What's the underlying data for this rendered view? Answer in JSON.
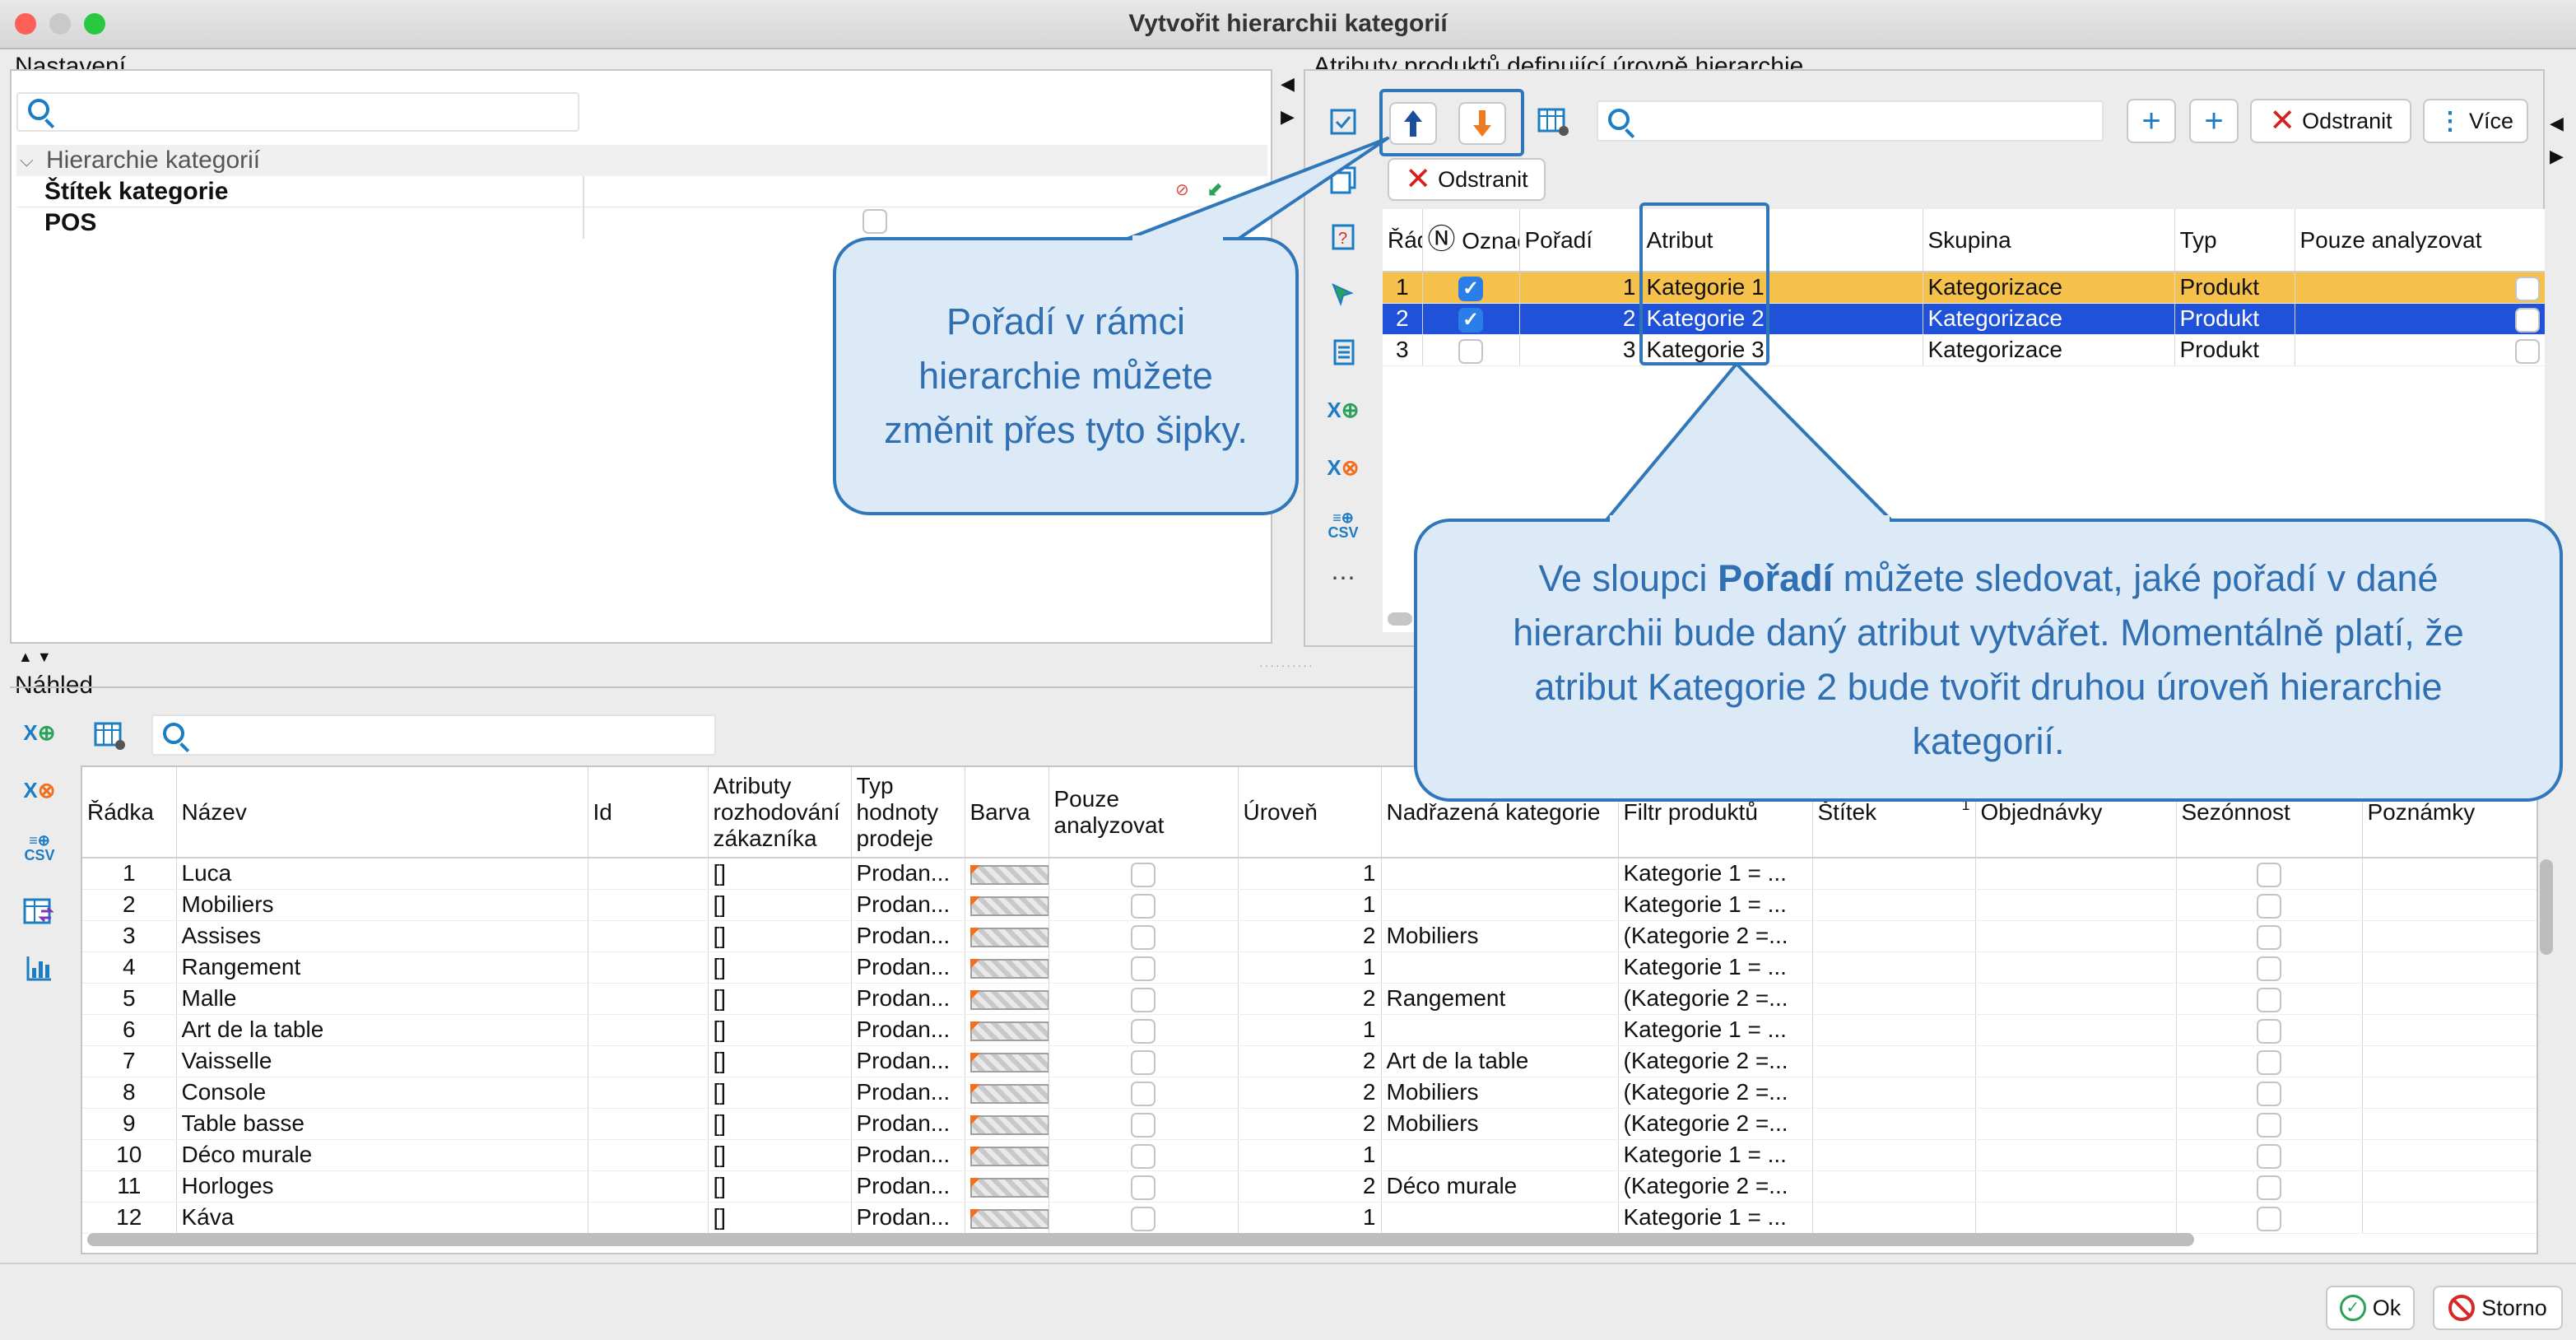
{
  "window": {
    "title": "Vytvořit hierarchii kategorií"
  },
  "settings": {
    "label": "Nastavení",
    "search_placeholder": "",
    "tree_group": "Hierarchie kategorií",
    "rows": [
      "Štítek kategorie",
      "POS"
    ]
  },
  "attrs": {
    "label": "Atributy produktů definující úrovně hierarchie",
    "search_placeholder": "",
    "remove_label": "Odstranit",
    "more_label": "Více",
    "remove2_label": "Odstranit",
    "columns": {
      "radka": "Řádka",
      "oznacene": "Označené",
      "poradi": "Pořadí",
      "atribut": "Atribut",
      "skupina": "Skupina",
      "typ": "Typ",
      "pouze": "Pouze analyzovat"
    },
    "rows": [
      {
        "radka": "1",
        "checked": true,
        "poradi": "1",
        "atribut": "Kategorie 1",
        "skupina": "Kategorizace",
        "typ": "Produkt"
      },
      {
        "radka": "2",
        "checked": true,
        "poradi": "2",
        "atribut": "Kategorie 2",
        "skupina": "Kategorizace",
        "typ": "Produkt"
      },
      {
        "radka": "3",
        "checked": false,
        "poradi": "3",
        "atribut": "Kategorie 3",
        "skupina": "Kategorizace",
        "typ": "Produkt"
      }
    ]
  },
  "callouts": {
    "arrows": "Pořadí v rámci hierarchie můžete změnit přes tyto šipky.",
    "order_pre": "Ve sloupci ",
    "order_bold": "Pořadí",
    "order_post": " můžete sledovat, jaké pořadí v dané hierarchii bude daný atribut vytvářet. Momentálně platí, že atribut Kategorie 2 bude tvořit druhou úroveň hierarchie kategorií."
  },
  "preview": {
    "label": "Náhled",
    "search_placeholder": "",
    "columns": {
      "radka": "Řádka",
      "nazev": "Název",
      "id": "Id",
      "atributy": "Atributy rozhodování zákazníka",
      "typ": "Typ hodnoty prodeje",
      "barva": "Barva",
      "pouze": "Pouze analyzovat",
      "uroven": "Úroveň",
      "nadrazena": "Nadřazená kategorie",
      "filtr": "Filtr produktů",
      "stitek": "Štítek",
      "stitek_sort": "1",
      "objednavky": "Objednávky",
      "sezonnost": "Sezónnost",
      "poznamky": "Poznámky"
    },
    "rows": [
      {
        "n": "1",
        "nazev": "Luca",
        "atr": "[]",
        "typ": "Prodan...",
        "uroven": "1",
        "nadr": "",
        "filtr": "Kategorie 1 = ..."
      },
      {
        "n": "2",
        "nazev": "Mobiliers",
        "atr": "[]",
        "typ": "Prodan...",
        "uroven": "1",
        "nadr": "",
        "filtr": "Kategorie 1 = ..."
      },
      {
        "n": "3",
        "nazev": "Assises",
        "atr": "[]",
        "typ": "Prodan...",
        "uroven": "2",
        "nadr": "Mobiliers",
        "filtr": "(Kategorie 2 =..."
      },
      {
        "n": "4",
        "nazev": "Rangement",
        "atr": "[]",
        "typ": "Prodan...",
        "uroven": "1",
        "nadr": "",
        "filtr": "Kategorie 1 = ..."
      },
      {
        "n": "5",
        "nazev": "Malle",
        "atr": "[]",
        "typ": "Prodan...",
        "uroven": "2",
        "nadr": "Rangement",
        "filtr": "(Kategorie 2 =..."
      },
      {
        "n": "6",
        "nazev": "Art de la table",
        "atr": "[]",
        "typ": "Prodan...",
        "uroven": "1",
        "nadr": "",
        "filtr": "Kategorie 1 = ..."
      },
      {
        "n": "7",
        "nazev": "Vaisselle",
        "atr": "[]",
        "typ": "Prodan...",
        "uroven": "2",
        "nadr": "Art de la table",
        "filtr": "(Kategorie 2 =..."
      },
      {
        "n": "8",
        "nazev": "Console",
        "atr": "[]",
        "typ": "Prodan...",
        "uroven": "2",
        "nadr": "Mobiliers",
        "filtr": "(Kategorie 2 =..."
      },
      {
        "n": "9",
        "nazev": "Table basse",
        "atr": "[]",
        "typ": "Prodan...",
        "uroven": "2",
        "nadr": "Mobiliers",
        "filtr": "(Kategorie 2 =..."
      },
      {
        "n": "10",
        "nazev": "Déco murale",
        "atr": "[]",
        "typ": "Prodan...",
        "uroven": "1",
        "nadr": "",
        "filtr": "Kategorie 1 = ..."
      },
      {
        "n": "11",
        "nazev": "Horloges",
        "atr": "[]",
        "typ": "Prodan...",
        "uroven": "2",
        "nadr": "Déco murale",
        "filtr": "(Kategorie 2 =..."
      },
      {
        "n": "12",
        "nazev": "Káva",
        "atr": "[]",
        "typ": "Prodan...",
        "uroven": "1",
        "nadr": "",
        "filtr": "Kategorie 1 = ..."
      }
    ]
  },
  "footer": {
    "ok": "Ok",
    "cancel": "Storno"
  },
  "colors": {
    "row_selected_yellow": "#f6c14a",
    "row_selected_blue": "#1f52d8",
    "callout_fill": "#dce9f6",
    "callout_border": "#2f77b8",
    "accent": "#1c7cc4"
  }
}
